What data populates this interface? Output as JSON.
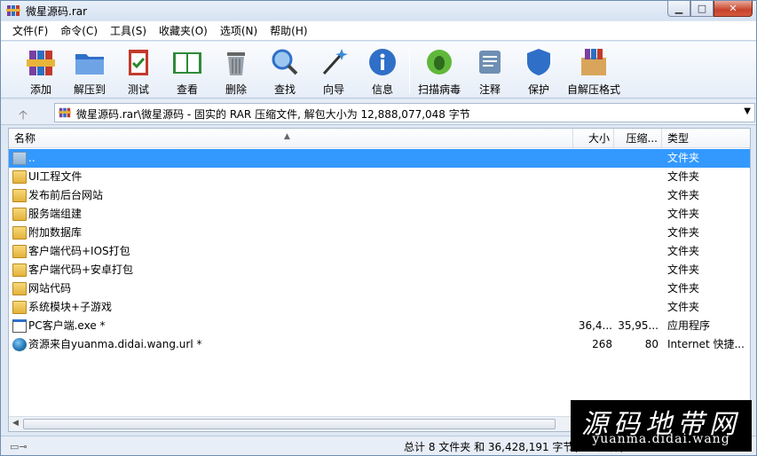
{
  "window": {
    "title": "微星源码.rar"
  },
  "menu": [
    "文件(F)",
    "命令(C)",
    "工具(S)",
    "收藏夹(O)",
    "选项(N)",
    "帮助(H)"
  ],
  "toolbar": [
    {
      "label": "添加",
      "icon": "add-archive-icon"
    },
    {
      "label": "解压到",
      "icon": "extract-folder-icon"
    },
    {
      "label": "测试",
      "icon": "test-clipboard-icon"
    },
    {
      "label": "查看",
      "icon": "view-book-icon"
    },
    {
      "label": "删除",
      "icon": "delete-trash-icon"
    },
    {
      "label": "查找",
      "icon": "find-magnifier-icon"
    },
    {
      "label": "向导",
      "icon": "wizard-wand-icon"
    },
    {
      "label": "信息",
      "icon": "info-icon"
    },
    {
      "label": "扫描病毒",
      "icon": "scan-virus-icon"
    },
    {
      "label": "注释",
      "icon": "comment-icon"
    },
    {
      "label": "保护",
      "icon": "protect-shield-icon"
    },
    {
      "label": "自解压格式",
      "icon": "sfx-box-icon"
    }
  ],
  "address": {
    "path": "微星源码.rar\\微星源码 - 固实的 RAR 压缩文件, 解包大小为 12,888,077,048 字节"
  },
  "columns": {
    "name": "名称",
    "size": "大小",
    "packed": "压缩...",
    "type": "类型"
  },
  "files": [
    {
      "name": "..",
      "size": "",
      "packed": "",
      "type": "文件夹",
      "icon": "parent-folder-icon",
      "selected": true
    },
    {
      "name": "UI工程文件",
      "size": "",
      "packed": "",
      "type": "文件夹",
      "icon": "folder-icon"
    },
    {
      "name": "发布前后台网站",
      "size": "",
      "packed": "",
      "type": "文件夹",
      "icon": "folder-icon"
    },
    {
      "name": "服务端组建",
      "size": "",
      "packed": "",
      "type": "文件夹",
      "icon": "folder-icon"
    },
    {
      "name": "附加数据库",
      "size": "",
      "packed": "",
      "type": "文件夹",
      "icon": "folder-icon"
    },
    {
      "name": "客户端代码+IOS打包",
      "size": "",
      "packed": "",
      "type": "文件夹",
      "icon": "folder-icon"
    },
    {
      "name": "客户端代码+安卓打包",
      "size": "",
      "packed": "",
      "type": "文件夹",
      "icon": "folder-icon"
    },
    {
      "name": "网站代码",
      "size": "",
      "packed": "",
      "type": "文件夹",
      "icon": "folder-icon"
    },
    {
      "name": "系统模块+子游戏",
      "size": "",
      "packed": "",
      "type": "文件夹",
      "icon": "folder-icon"
    },
    {
      "name": "PC客户端.exe *",
      "size": "36,4...",
      "packed": "35,95...",
      "type": "应用程序",
      "icon": "exe-icon"
    },
    {
      "name": "资源来自yuanma.didai.wang.url *",
      "size": "268",
      "packed": "80",
      "type": "Internet 快捷...",
      "icon": "url-globe-icon"
    }
  ],
  "status": {
    "text": "总计 8 文件夹 和 36,428,191 字节(2 个文件)"
  },
  "watermark": {
    "line1": "源码地带网",
    "line2": "yuanma.didai.wang"
  }
}
